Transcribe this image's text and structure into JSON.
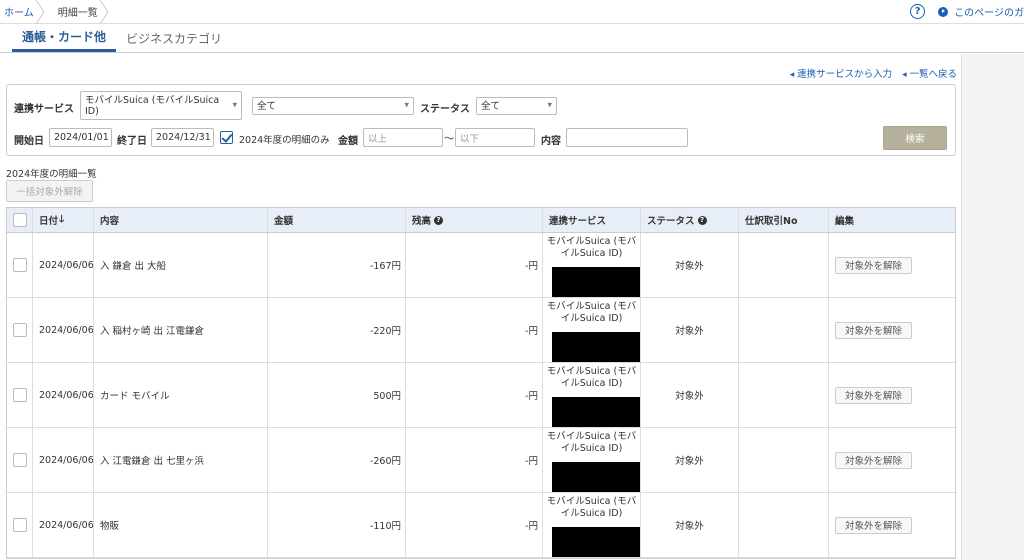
{
  "breadcrumb": {
    "home": "ホーム",
    "current": "明細一覧"
  },
  "help": {
    "guide_label": "このページのガ"
  },
  "tabs": [
    {
      "label": "通帳・カード他",
      "active": true
    },
    {
      "label": "ビジネスカテゴリ",
      "active": false
    }
  ],
  "actions": {
    "link_input": "連携サービスから入力",
    "back_to_list": "一覧へ戻る"
  },
  "filter": {
    "service_label": "連携サービス",
    "service_value": "モバイルSuica (モバイルSuica ID)",
    "service_sub_value": "全て",
    "status_label": "ステータス",
    "status_value": "全て",
    "start_label": "開始日",
    "start_value": "2024/01/01",
    "end_label": "終了日",
    "end_value": "2024/12/31",
    "year_only_label": "2024年度の明細のみ",
    "amount_label": "金額",
    "amount_min_placeholder": "以上",
    "amount_tilde": "〜",
    "amount_max_placeholder": "以下",
    "content_label": "内容",
    "search_button": "検索"
  },
  "list": {
    "title": "2024年度の明細一覧",
    "bulk_button": "一括対象外解除"
  },
  "table": {
    "headers": {
      "date": "日付",
      "content": "内容",
      "amount": "金額",
      "balance": "残高",
      "service": "連携サービス",
      "status": "ステータス",
      "journal": "仕訳取引No",
      "edit": "編集"
    },
    "rows": [
      {
        "date": "2024/06/06",
        "content": "入 鎌倉 出 大船",
        "amount": "-167円",
        "balance": "-円",
        "service": "モバイルSuica (モバイルSuica ID)",
        "status": "対象外",
        "action": "対象外を解除"
      },
      {
        "date": "2024/06/06",
        "content": "入 稲村ヶ崎 出 江電鎌倉",
        "amount": "-220円",
        "balance": "-円",
        "service": "モバイルSuica (モバイルSuica ID)",
        "status": "対象外",
        "action": "対象外を解除"
      },
      {
        "date": "2024/06/06",
        "content": "カード モバイル",
        "amount": "500円",
        "balance": "-円",
        "service": "モバイルSuica (モバイルSuica ID)",
        "status": "対象外",
        "action": "対象外を解除"
      },
      {
        "date": "2024/06/06",
        "content": "入 江電鎌倉 出 七里ヶ浜",
        "amount": "-260円",
        "balance": "-円",
        "service": "モバイルSuica (モバイルSuica ID)",
        "status": "対象外",
        "action": "対象外を解除"
      },
      {
        "date": "2024/06/06",
        "content": "物販",
        "amount": "-110円",
        "balance": "-円",
        "service": "モバイルSuica (モバイルSuica ID)",
        "status": "対象外",
        "action": "対象外を解除"
      }
    ]
  }
}
